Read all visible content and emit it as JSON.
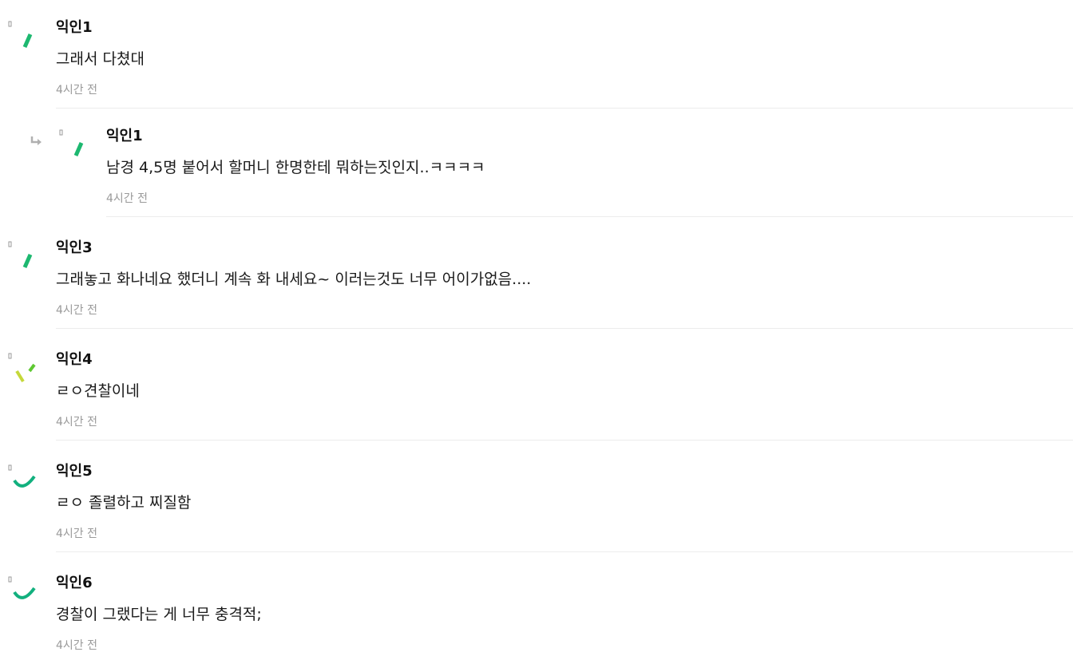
{
  "comments": [
    {
      "author": "익인1",
      "text": "그래서 다쳤대",
      "time": "4시간 전",
      "is_reply": false,
      "avatar_icon": "green-slash-icon",
      "avatar_color": "#1db870"
    },
    {
      "author": "익인1",
      "text": "남경 4,5명 붙어서 할머니 한명한테 뭐하는짓인지..ㅋㅋㅋㅋ",
      "time": "4시간 전",
      "is_reply": true,
      "avatar_icon": "green-slash-icon",
      "avatar_color": "#1db870"
    },
    {
      "author": "익인3",
      "text": "그래놓고 화나네요 했더니 계속 화 내세요~ 이러는것도 너무 어이가없음....",
      "time": "4시간 전",
      "is_reply": false,
      "avatar_icon": "green-slash-icon",
      "avatar_color": "#1db870"
    },
    {
      "author": "익인4",
      "text": "ㄹㅇ견찰이네",
      "time": "4시간 전",
      "is_reply": false,
      "avatar_icon": "double-slash-icon",
      "avatar_color": "#b7d433"
    },
    {
      "author": "익인5",
      "text": "ㄹㅇ 졸렬하고 찌질함",
      "time": "4시간 전",
      "is_reply": false,
      "avatar_icon": "arc-icon",
      "avatar_color": "#12b07e"
    },
    {
      "author": "익인6",
      "text": "경찰이 그랬다는 게 너무 충격적;",
      "time": "4시간 전",
      "is_reply": false,
      "avatar_icon": "arc-icon",
      "avatar_color": "#12b07e"
    }
  ],
  "reply_icon": "reply-arrow-icon",
  "colors": {
    "divider": "#ececec",
    "time_text": "#9a9a9a",
    "reply_arrow": "#b0b0b0"
  }
}
